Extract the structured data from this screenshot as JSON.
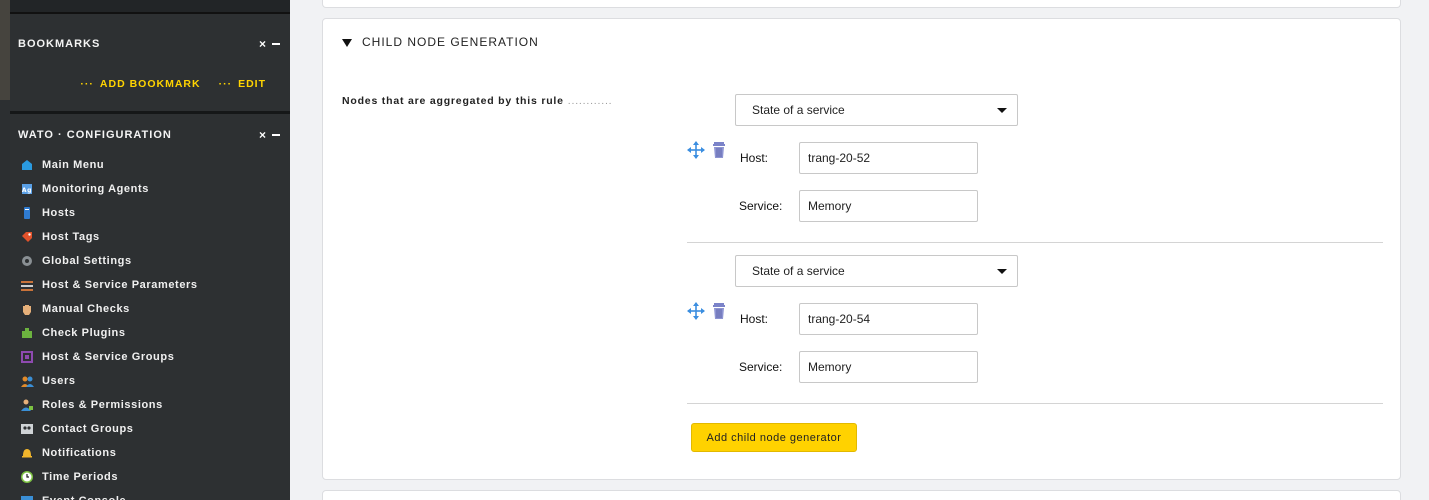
{
  "sidebar": {
    "bookmarks": {
      "title": "BOOKMARKS",
      "add_label": "ADD BOOKMARK",
      "edit_label": "EDIT",
      "dots": "···"
    },
    "wato": {
      "title": "WATO · CONFIGURATION",
      "items": [
        {
          "label": "Main Menu",
          "icon": "main-menu-icon",
          "color": "#2a9ae0"
        },
        {
          "label": "Monitoring Agents",
          "icon": "agents-icon",
          "color": "#5aa0e6"
        },
        {
          "label": "Hosts",
          "icon": "hosts-icon",
          "color": "#2f7bd0"
        },
        {
          "label": "Host Tags",
          "icon": "tag-icon",
          "color": "#e2522b"
        },
        {
          "label": "Global Settings",
          "icon": "gear-icon",
          "color": "#8a9094"
        },
        {
          "label": "Host & Service Parameters",
          "icon": "parameters-icon",
          "color": "#c9733a"
        },
        {
          "label": "Manual Checks",
          "icon": "hand-icon",
          "color": "#e6b07a"
        },
        {
          "label": "Check Plugins",
          "icon": "plugin-icon",
          "color": "#6cb33f"
        },
        {
          "label": "Host & Service Groups",
          "icon": "groups-icon",
          "color": "#8e4ab0"
        },
        {
          "label": "Users",
          "icon": "users-icon",
          "color": "#e08a2a"
        },
        {
          "label": "Roles & Permissions",
          "icon": "roles-icon",
          "color": "#3a8fd6"
        },
        {
          "label": "Contact Groups",
          "icon": "contact-groups-icon",
          "color": "#cfd3d6"
        },
        {
          "label": "Notifications",
          "icon": "bell-icon",
          "color": "#f2b62c"
        },
        {
          "label": "Time Periods",
          "icon": "clock-icon",
          "color": "#7cc242"
        },
        {
          "label": "Event Console",
          "icon": "event-console-icon",
          "color": "#3a8fd6"
        }
      ]
    },
    "close_glyph": "×"
  },
  "section": {
    "title": "CHILD NODE GENERATION",
    "row_label": "Nodes that are aggregated by this rule",
    "row_dots": "............"
  },
  "generators": [
    {
      "type": "State of a service",
      "host_label": "Host:",
      "host": "trang-20-52",
      "service_label": "Service:",
      "service": "Memory"
    },
    {
      "type": "State of a service",
      "host_label": "Host:",
      "host": "trang-20-54",
      "service_label": "Service:",
      "service": "Memory"
    }
  ],
  "add_button": "Add child node generator",
  "colors": {
    "accent": "#ffd200",
    "sidebar_bg": "#2d3032",
    "link": "#ffd400"
  }
}
